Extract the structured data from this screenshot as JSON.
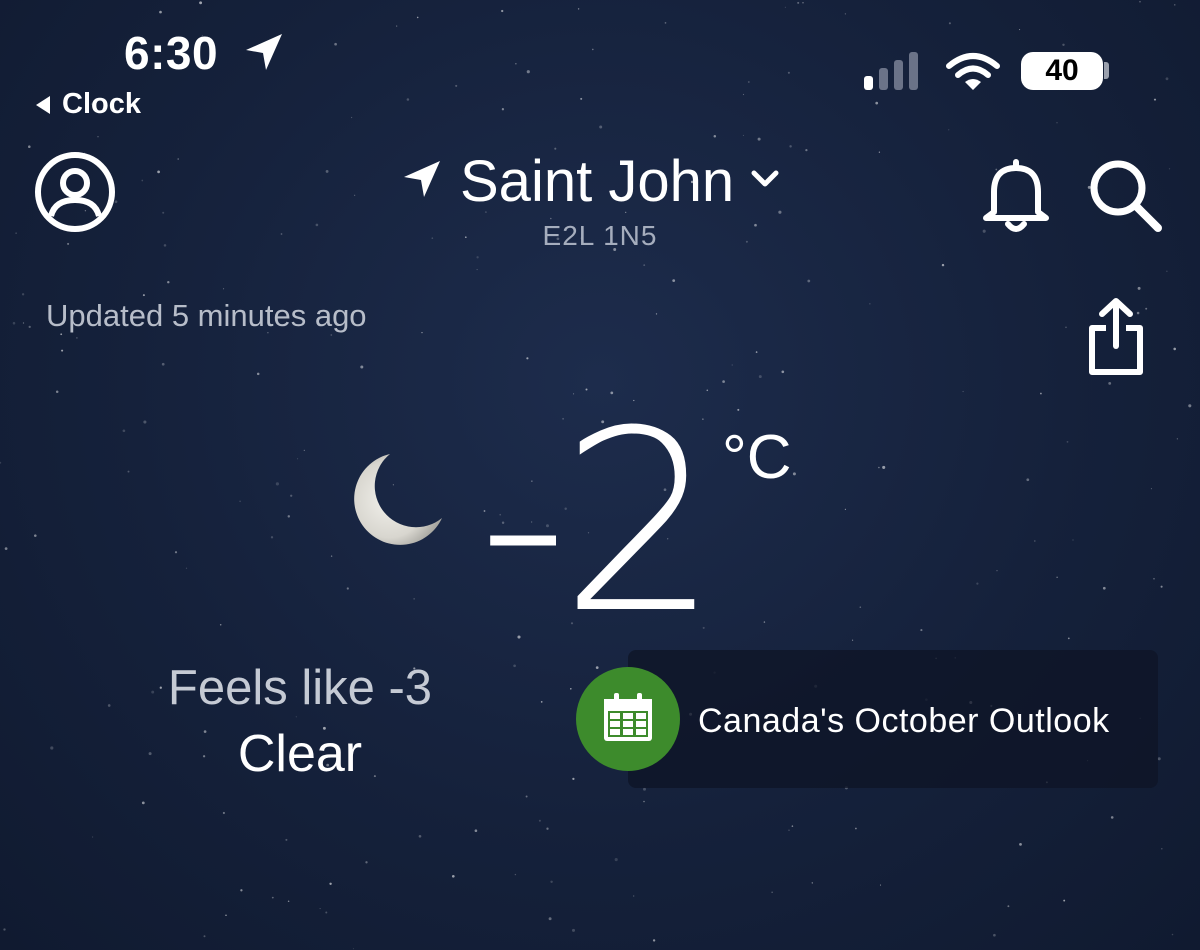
{
  "status_bar": {
    "time": "6:30",
    "back_label": "Clock",
    "battery_level": "40",
    "signal_bars_active": 1,
    "signal_bars_total": 4
  },
  "header": {
    "city": "Saint John",
    "postal_code": "E2L 1N5"
  },
  "updated_text": "Updated 5 minutes ago",
  "current": {
    "temperature": "-2",
    "unit": "°C",
    "feels_like": "Feels like -3",
    "condition": "Clear"
  },
  "promo": {
    "label": "Canada's October Outlook",
    "accent_color": "#3d8b2c"
  },
  "icons": {
    "location": "location-arrow-icon",
    "profile": "profile-icon",
    "bell": "bell-icon",
    "search": "search-icon",
    "share": "share-icon",
    "moon": "crescent-moon-icon",
    "calendar": "calendar-icon"
  }
}
